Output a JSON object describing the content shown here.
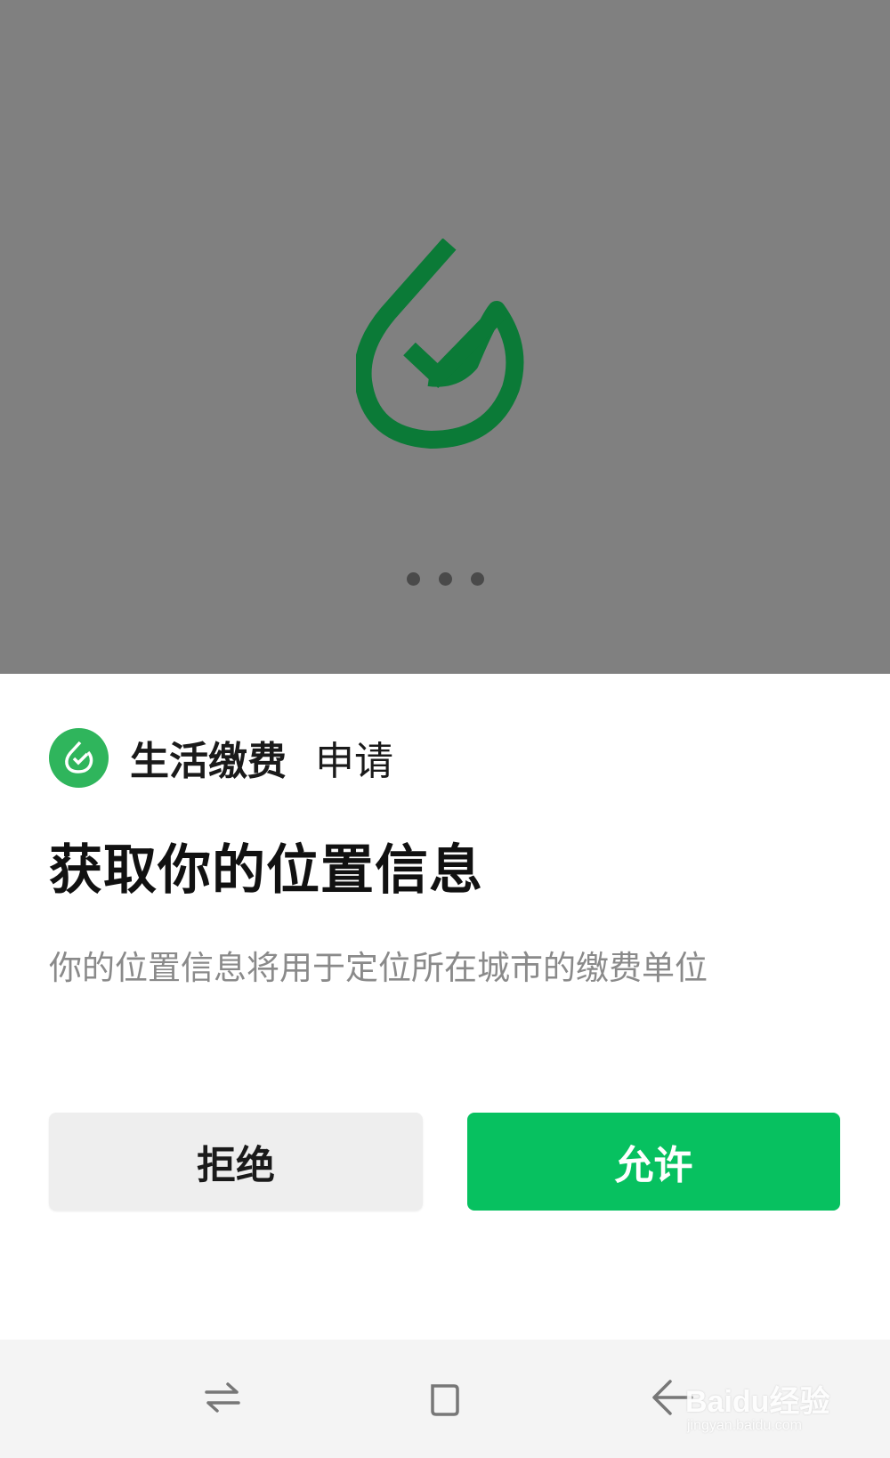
{
  "app": {
    "name": "生活缴费",
    "action": "申请",
    "icon": "water-drop-check-icon",
    "brand_color": "#07c160",
    "icon_color": "#2fb55c",
    "splash_logo_color": "#0b7a37"
  },
  "splash": {
    "background": "#808080",
    "dots_count": 3
  },
  "dialog": {
    "title": "获取你的位置信息",
    "description": "你的位置信息将用于定位所在城市的缴费单位",
    "deny_label": "拒绝",
    "allow_label": "允许"
  },
  "navbar": {
    "recent_icon": "swap-arrows-icon",
    "home_icon": "square-icon",
    "back_icon": "back-arrow-icon"
  },
  "watermark": {
    "text": "Baidu经验",
    "sub": "jingyan.baidu.com"
  }
}
